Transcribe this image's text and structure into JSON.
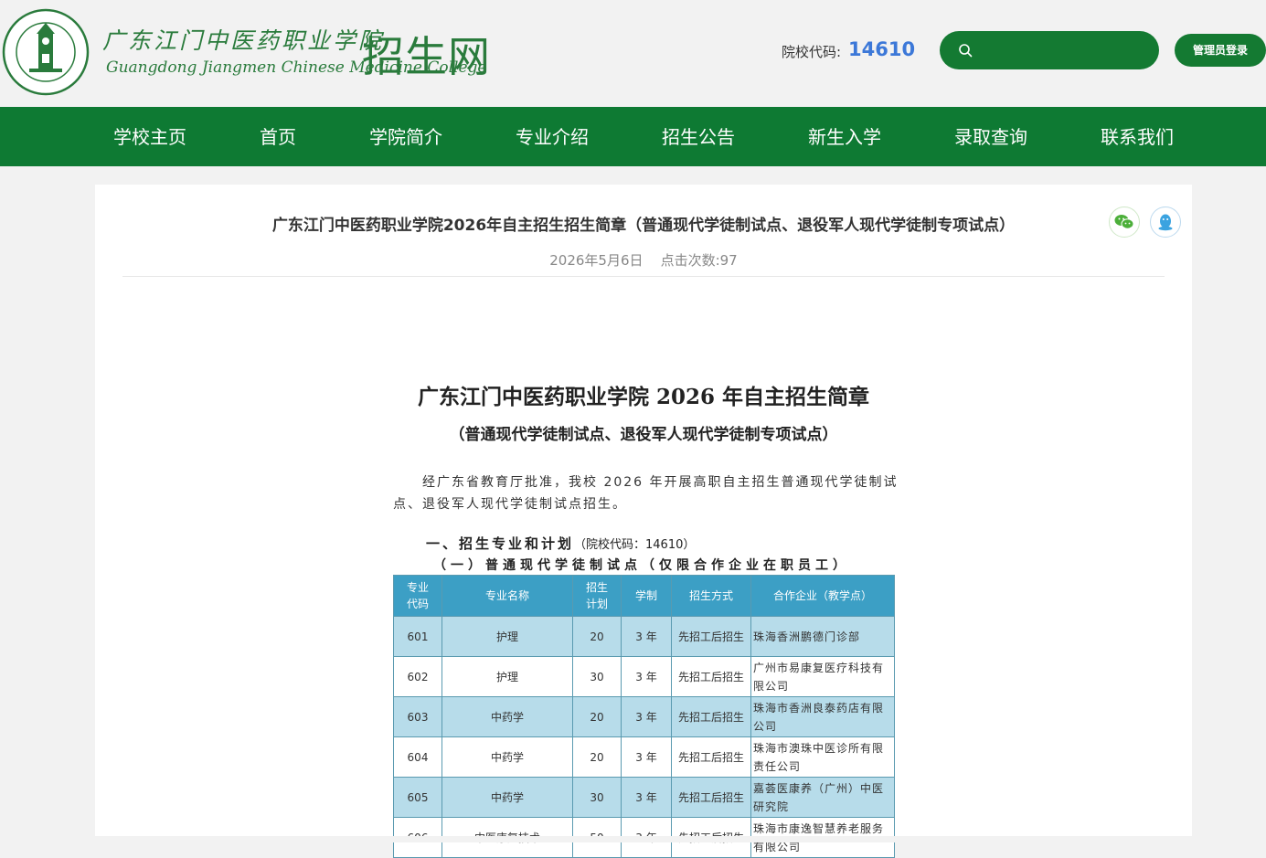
{
  "header": {
    "brand_cn": "广东江门中医药职业学院",
    "brand_en": "Guangdong Jiangmen Chinese Medicine College",
    "site_name": "招生网",
    "school_code_label": "院校代码:",
    "school_code_value": "14610",
    "search_placeholder": "",
    "admin_login": "管理员登录",
    "colors": {
      "brand_green": "#0e7a33",
      "code_blue": "#3c78d8"
    }
  },
  "nav": [
    {
      "label": "学校主页"
    },
    {
      "label": "首页"
    },
    {
      "label": "学院简介"
    },
    {
      "label": "专业介绍"
    },
    {
      "label": "招生公告"
    },
    {
      "label": "新生入学"
    },
    {
      "label": "录取查询"
    },
    {
      "label": "联系我们"
    }
  ],
  "article": {
    "title": "广东江门中医药职业学院2026年自主招生招生简章（普通现代学徒制试点、退役军人现代学徒制专项试点）",
    "meta": "2026年5月6日    点击次数:97",
    "share_icons": [
      "wechat-icon",
      "qq-icon"
    ],
    "doc_title": "广东江门中医药职业学院 2026 年自主招生简章",
    "doc_subtitle": "（普通现代学徒制试点、退役军人现代学徒制专项试点）",
    "intro_line1": "经广东省教育厅批准，我校 2026 年开展高职自主招生普通现代学徒制试",
    "intro_line2": "点、退役军人现代学徒制试点招生。",
    "section1_title": "一、招生专业和计划",
    "section1_code": "（院校代码：14610）",
    "section1_sub": "（一）普通现代学徒制试点（仅限合作企业在职员工）"
  },
  "table": {
    "headers": [
      "专业\n代码",
      "专业名称",
      "招生\n计划",
      "学制",
      "招生方式",
      "合作企业（教学点）"
    ],
    "rows": [
      {
        "code": "601",
        "major": "护理",
        "plan": "20",
        "years": "3 年",
        "mode": "先招工后招生",
        "partner": "珠海香洲鹏德门诊部"
      },
      {
        "code": "602",
        "major": "护理",
        "plan": "30",
        "years": "3 年",
        "mode": "先招工后招生",
        "partner": "广州市易康复医疗科技有限公司"
      },
      {
        "code": "603",
        "major": "中药学",
        "plan": "20",
        "years": "3 年",
        "mode": "先招工后招生",
        "partner": "珠海市香洲良泰药店有限公司"
      },
      {
        "code": "604",
        "major": "中药学",
        "plan": "20",
        "years": "3 年",
        "mode": "先招工后招生",
        "partner": "珠海市澳珠中医诊所有限责任公司"
      },
      {
        "code": "605",
        "major": "中药学",
        "plan": "30",
        "years": "3 年",
        "mode": "先招工后招生",
        "partner": "嘉荟医康养（广州）中医研究院"
      },
      {
        "code": "606",
        "major": "中医康复技术",
        "plan": "50",
        "years": "3 年",
        "mode": "先招工后招生",
        "partner": "珠海市康逸智慧养老服务有限公司"
      }
    ]
  }
}
